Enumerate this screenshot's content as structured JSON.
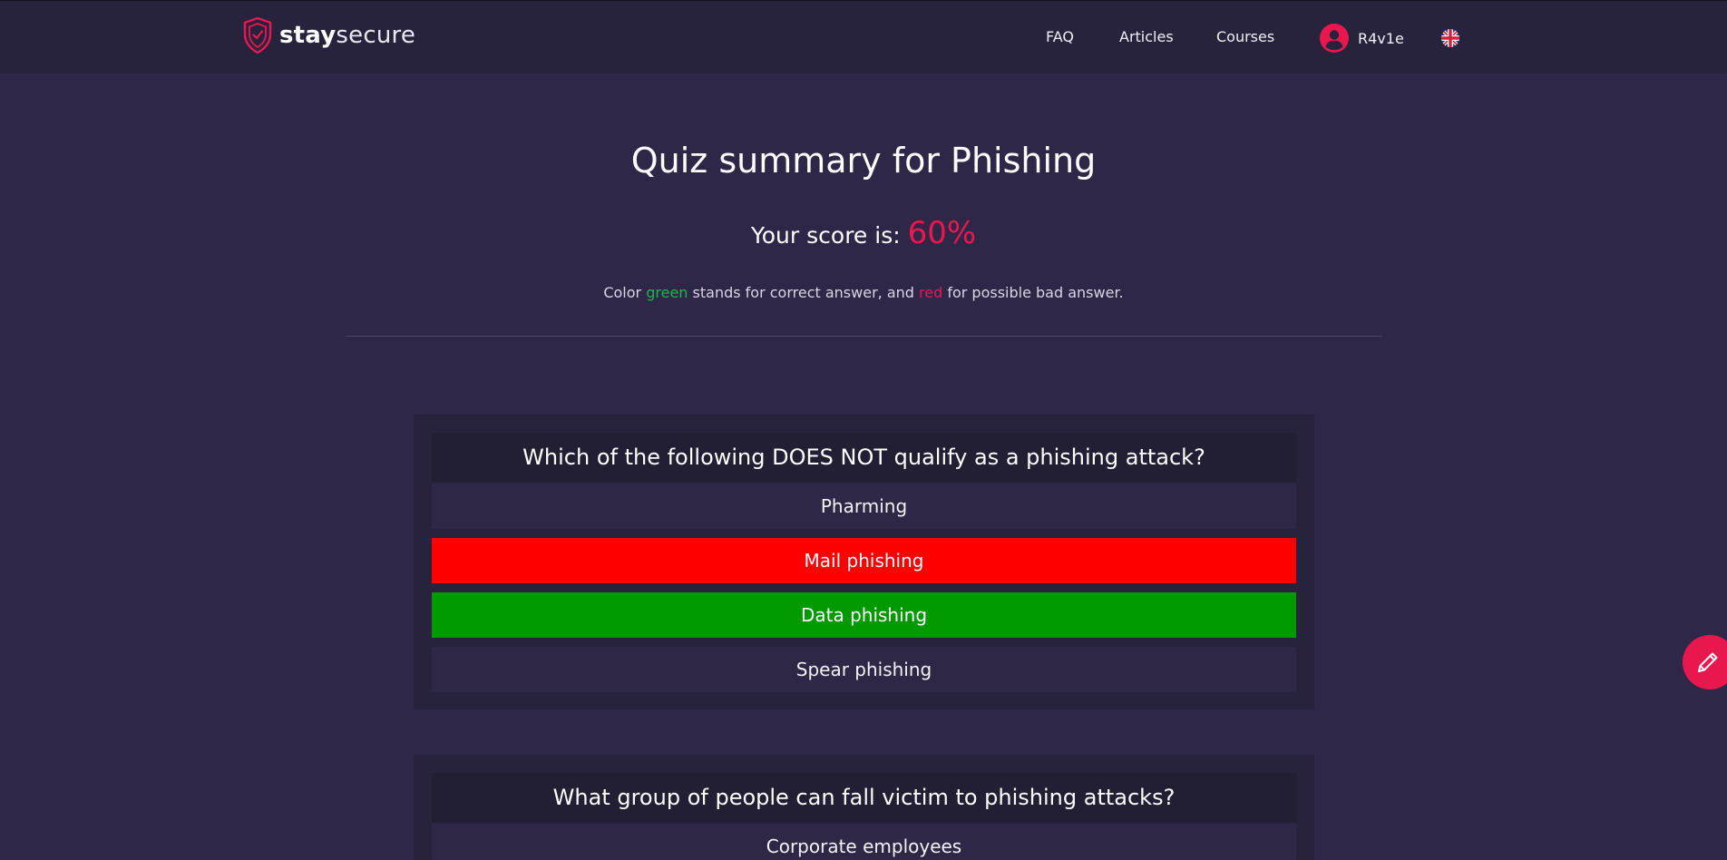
{
  "header": {
    "logo": {
      "bold": "stay",
      "light": "secure",
      "icon": "shield-check-icon"
    },
    "nav": [
      {
        "label": "FAQ"
      },
      {
        "label": "Articles"
      },
      {
        "label": "Courses"
      }
    ],
    "user": {
      "name": "R4v1e",
      "icon": "user-avatar-icon"
    },
    "language_icon": "uk-flag-icon"
  },
  "summary": {
    "title": "Quiz summary for Phishing",
    "score_label": "Your score is:",
    "score_value": "60%",
    "legend": {
      "prefix": "Color",
      "green_word": "green",
      "middle": "stands for correct answer, and",
      "red_word": "red",
      "suffix": "for possible bad answer."
    }
  },
  "questions": [
    {
      "title": "Which of the following DOES NOT qualify as a phishing attack?",
      "answers": [
        {
          "label": "Pharming",
          "state": "neutral"
        },
        {
          "label": "Mail phishing",
          "state": "wrong"
        },
        {
          "label": "Data phishing",
          "state": "correct"
        },
        {
          "label": "Spear phishing",
          "state": "neutral"
        }
      ]
    },
    {
      "title": "What group of people can fall victim to phishing attacks?",
      "answers": [
        {
          "label": "Corporate employees",
          "state": "neutral"
        }
      ]
    }
  ],
  "fab": {
    "icon": "pencil-icon"
  },
  "colors": {
    "accent": "#e8184f",
    "correct": "#009a00",
    "wrong": "#ff0000",
    "background": "#2f2748",
    "header": "#27233c"
  }
}
